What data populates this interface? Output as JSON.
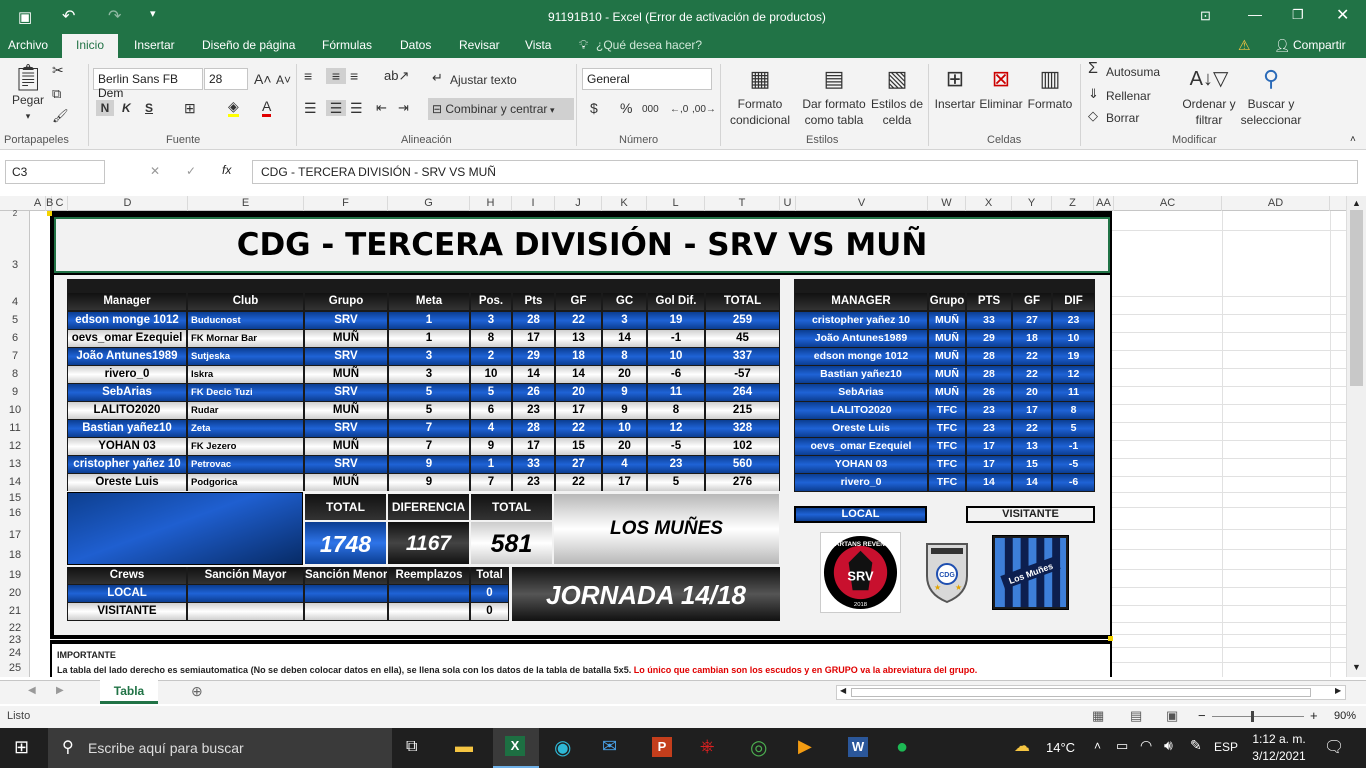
{
  "window": {
    "title": "91191B10 - Excel (Error de activación de productos)"
  },
  "ribbon_tabs": [
    "Archivo",
    "Inicio",
    "Insertar",
    "Diseño de página",
    "Fórmulas",
    "Datos",
    "Revisar",
    "Vista",
    "¿Qué desea hacer?"
  ],
  "share_label": "Compartir",
  "ribbon": {
    "paste": "Pegar",
    "font_name": "Berlin Sans FB Dem",
    "font_size": "28",
    "wrap_text": "Ajustar texto",
    "merge_center": "Combinar y centrar",
    "number_format": "General",
    "cond_format": "Formato condicional",
    "format_table": "Dar formato como tabla",
    "cell_styles": "Estilos de celda",
    "insert": "Insertar",
    "delete": "Eliminar",
    "format": "Formato",
    "autosum": "Autosuma",
    "fill": "Rellenar",
    "clear": "Borrar",
    "sort_filter": "Ordenar y filtrar",
    "find_select": "Buscar y seleccionar",
    "groups": [
      "Portapapeles",
      "Fuente",
      "Alineación",
      "Número",
      "Estilos",
      "Celdas",
      "Modificar"
    ]
  },
  "formula_bar": {
    "name_box": "C3",
    "formula": "CDG - TERCERA DIVISIÓN - SRV VS MUÑ"
  },
  "columns": [
    "A",
    "B",
    "C",
    "D",
    "E",
    "F",
    "G",
    "H",
    "I",
    "J",
    "K",
    "L",
    "T",
    "U",
    "V",
    "W",
    "X",
    "Y",
    "Z",
    "AA",
    "AC",
    "AD"
  ],
  "rows": [
    "2",
    "3",
    "4",
    "5",
    "6",
    "7",
    "8",
    "9",
    "10",
    "11",
    "12",
    "13",
    "14",
    "15",
    "16",
    "17",
    "18",
    "19",
    "20",
    "21",
    "22",
    "23",
    "24",
    "25"
  ],
  "banner": "CDG - TERCERA DIVISIÓN - SRV VS MUÑ",
  "main_table": {
    "headers": [
      "Manager",
      "Club",
      "Grupo",
      "Meta",
      "Pos.",
      "Pts",
      "GF",
      "GC",
      "Gol Dif.",
      "TOTAL"
    ],
    "rows": [
      [
        "edson monge 1012",
        "Buducnost",
        "SRV",
        "1",
        "3",
        "28",
        "22",
        "3",
        "19",
        "259"
      ],
      [
        "oevs_omar Ezequiel",
        "FK Mornar Bar",
        "MUÑ",
        "1",
        "8",
        "17",
        "13",
        "14",
        "-1",
        "45"
      ],
      [
        "João Antunes1989",
        "Sutjeska",
        "SRV",
        "3",
        "2",
        "29",
        "18",
        "8",
        "10",
        "337"
      ],
      [
        "rivero_0",
        "Iskra",
        "MUÑ",
        "3",
        "10",
        "14",
        "14",
        "20",
        "-6",
        "-57"
      ],
      [
        "SebArias",
        "FK Decic Tuzi",
        "SRV",
        "5",
        "5",
        "26",
        "20",
        "9",
        "11",
        "264"
      ],
      [
        "LALITO2020",
        "Rudar",
        "MUÑ",
        "5",
        "6",
        "23",
        "17",
        "9",
        "8",
        "215"
      ],
      [
        "Bastian yañez10",
        "Zeta",
        "SRV",
        "7",
        "4",
        "28",
        "22",
        "10",
        "12",
        "328"
      ],
      [
        "YOHAN 03",
        "FK Jezero",
        "MUÑ",
        "7",
        "9",
        "17",
        "15",
        "20",
        "-5",
        "102"
      ],
      [
        "cristopher yañez 10",
        "Petrovac",
        "SRV",
        "9",
        "1",
        "33",
        "27",
        "4",
        "23",
        "560"
      ],
      [
        "Oreste Luis",
        "Podgorica",
        "MUÑ",
        "9",
        "7",
        "23",
        "22",
        "17",
        "5",
        "276"
      ]
    ]
  },
  "totals": {
    "total_label": "TOTAL",
    "diff_label": "DIFERENCIA",
    "total_left": "1748",
    "diff": "1167",
    "total_right": "581",
    "winner": "LOS MUÑES"
  },
  "crews": {
    "headers": [
      "Crews",
      "Sanción Mayor",
      "Sanción Menor",
      "Reemplazos",
      "Total"
    ],
    "rows": [
      [
        "LOCAL",
        "",
        "",
        "",
        "0"
      ],
      [
        "VISITANTE",
        "",
        "",
        "",
        "0"
      ]
    ]
  },
  "jornada": "JORNADA 14/18",
  "ranking": {
    "headers": [
      "MANAGER",
      "Grupo",
      "PTS",
      "GF",
      "DIF"
    ],
    "rows": [
      [
        "cristopher yañez 10",
        "MUÑ",
        "33",
        "27",
        "23"
      ],
      [
        "João Antunes1989",
        "MUÑ",
        "29",
        "18",
        "10"
      ],
      [
        "edson monge 1012",
        "MUÑ",
        "28",
        "22",
        "19"
      ],
      [
        "Bastian yañez10",
        "MUÑ",
        "28",
        "22",
        "12"
      ],
      [
        "SebArias",
        "MUÑ",
        "26",
        "20",
        "11"
      ],
      [
        "LALITO2020",
        "TFC",
        "23",
        "17",
        "8"
      ],
      [
        "Oreste Luis",
        "TFC",
        "23",
        "22",
        "5"
      ],
      [
        "oevs_omar Ezequiel",
        "TFC",
        "17",
        "13",
        "-1"
      ],
      [
        "YOHAN 03",
        "TFC",
        "17",
        "15",
        "-5"
      ],
      [
        "rivero_0",
        "TFC",
        "14",
        "14",
        "-6"
      ]
    ]
  },
  "local_label": "LOCAL",
  "visitante_label": "VISITANTE",
  "logos": {
    "srv_text": "SPARTANS REVENGE",
    "srv_letters": "SRV",
    "srv_year": "2018",
    "cdg": "CDG",
    "munes": "Los Muñes"
  },
  "notes": {
    "title": "IMPORTANTE",
    "line1": "La tabla del lado derecho es semiautomatica (No se deben colocar datos en ella), se llena sola con  los datos de la tabla de batalla 5x5.",
    "line1_red": "Lo único que cambian son los escudos y en GRUPO va la abreviatura del grupo."
  },
  "sheet_tab": "Tabla",
  "status": {
    "ready": "Listo",
    "zoom": "90%"
  },
  "taskbar": {
    "search": "Escribe aquí para buscar",
    "temp": "14°C",
    "lang": "ESP",
    "time": "1:12 a. m.",
    "date": "3/12/2021"
  },
  "colors": {
    "excel_green": "#217346",
    "row_blue": "#1f63d6",
    "note_red": "#e00000"
  }
}
